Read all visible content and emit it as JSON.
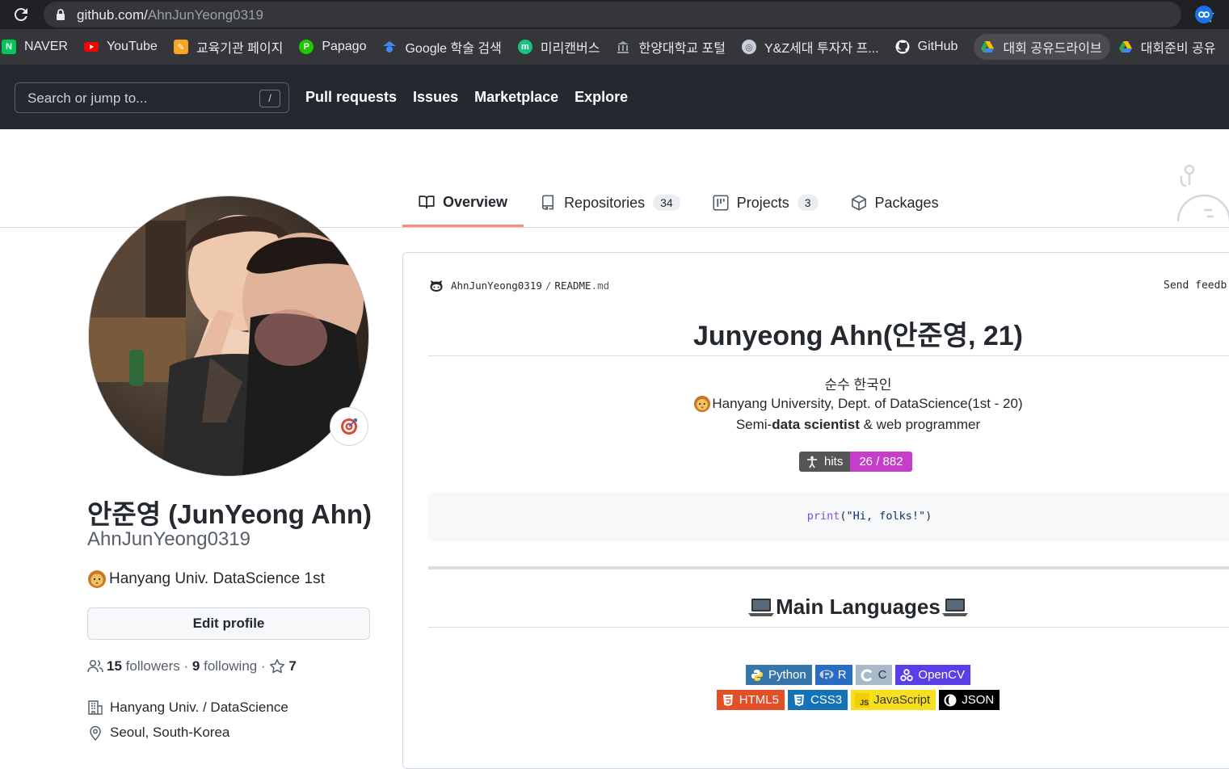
{
  "browser": {
    "url_host": "github.com/",
    "url_path": "AhnJunYeong0319",
    "bookmarks": [
      {
        "label": "NAVER",
        "icon": "naver-icon",
        "color": "#03c75a"
      },
      {
        "label": "YouTube",
        "icon": "youtube-icon",
        "color": "#ff0000"
      },
      {
        "label": "교육기관 페이지",
        "icon": "pencil-icon",
        "color": "#f5a623"
      },
      {
        "label": "Papago",
        "icon": "papago-icon",
        "color": "#1ec800"
      },
      {
        "label": "Google 학술 검색",
        "icon": "scholar-icon",
        "color": "#4285f4"
      },
      {
        "label": "미리캔버스",
        "icon": "miricanvas-icon",
        "color": "#19c37d"
      },
      {
        "label": "한양대학교 포털",
        "icon": "university-icon",
        "color": "#9aa0a6"
      },
      {
        "label": "Y&Z세대 투자자 프...",
        "icon": "globe-icon",
        "color": "#c8cdd8"
      },
      {
        "label": "GitHub",
        "icon": "github-icon",
        "color": "#ffffff"
      },
      {
        "label": "대회 공유드라이브",
        "icon": "drive-icon",
        "color": "#fbbc04"
      },
      {
        "label": "대회준비 공유",
        "icon": "drive-icon",
        "color": "#fbbc04"
      }
    ]
  },
  "header": {
    "search_placeholder": "Search or jump to...",
    "slash": "/",
    "nav": [
      "Pull requests",
      "Issues",
      "Marketplace",
      "Explore"
    ]
  },
  "tabs": [
    {
      "label": "Overview",
      "icon": "book-icon",
      "count": null,
      "active": true
    },
    {
      "label": "Repositories",
      "icon": "repo-icon",
      "count": "34",
      "active": false
    },
    {
      "label": "Projects",
      "icon": "project-icon",
      "count": "3",
      "active": false
    },
    {
      "label": "Packages",
      "icon": "package-icon",
      "count": null,
      "active": false
    }
  ],
  "profile": {
    "full_name": "안준영 (JunYeong Ahn)",
    "username": "AhnJunYeong0319",
    "bio": "Hanyang Univ. DataScience 1st",
    "edit_label": "Edit profile",
    "followers_count": "15",
    "followers_label": "followers",
    "dot1": "·",
    "following_count": "9",
    "following_label": "following",
    "dot2": "·",
    "stars_count": "7",
    "organization": "Hanyang Univ. / DataScience",
    "location": "Seoul, South-Korea"
  },
  "readme": {
    "owner": "AhnJunYeong0319",
    "slash": "/",
    "file_base": "README",
    "file_ext": ".md",
    "send_feedback": "Send feedb",
    "title": "Junyeong Ahn(안준영, 21)",
    "line1": "순수 한국인",
    "line2": "Hanyang University, Dept. of DataScience(1st - 20)",
    "line3_pre": "Semi-",
    "line3_bold": "data scientist",
    "line3_post": " & web programmer",
    "hits_label": "hits",
    "hits_value": "26 / 882",
    "code_fn": "print",
    "code_open": "(",
    "code_str": "\"Hi, folks!\"",
    "code_close": ")",
    "section_title": "Main Languages",
    "badges_row1": [
      {
        "label": "Python",
        "bg": "#3776ab",
        "icon": "python-icon"
      },
      {
        "label": "R",
        "bg": "#276dc3",
        "icon": "r-icon"
      },
      {
        "label": "C",
        "bg": "#a8b9cc",
        "icon": "c-icon"
      },
      {
        "label": "OpenCV",
        "bg": "#5c3ee8",
        "icon": "opencv-icon"
      }
    ],
    "badges_row2": [
      {
        "label": "HTML5",
        "bg": "#e34f26",
        "icon": "html5-icon"
      },
      {
        "label": "CSS3",
        "bg": "#1572b6",
        "icon": "css3-icon"
      },
      {
        "label": "JavaScript",
        "bg": "#f7df1e",
        "icon": "javascript-icon"
      },
      {
        "label": "JSON",
        "bg": "#000000",
        "icon": "json-icon"
      }
    ]
  }
}
